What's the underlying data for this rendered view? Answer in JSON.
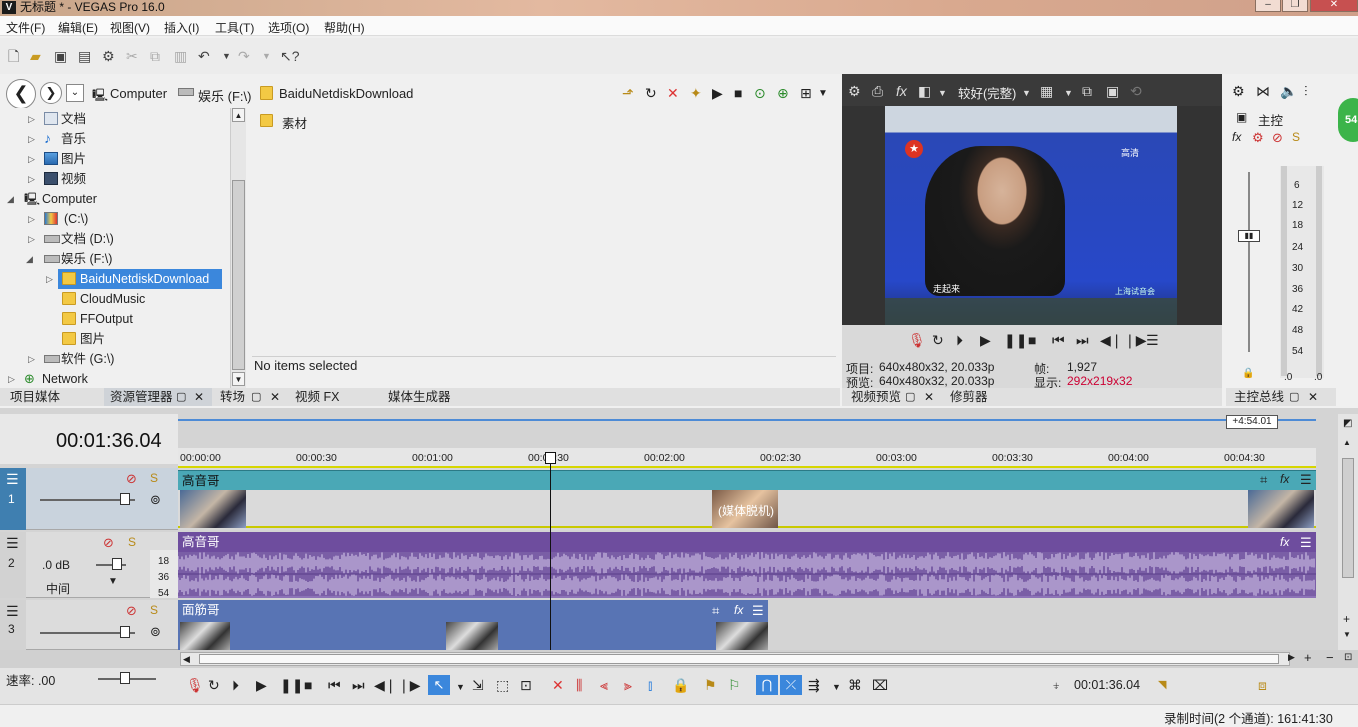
{
  "window": {
    "title": "无标题 * - VEGAS Pro 16.0",
    "logo": "V"
  },
  "menu": [
    "文件(F)",
    "编辑(E)",
    "视图(V)",
    "插入(I)",
    "工具(T)",
    "选项(O)",
    "帮助(H)"
  ],
  "explorer": {
    "path": [
      "Computer",
      "娱乐 (F:\\)",
      "BaiduNetdiskDownload"
    ],
    "tree": [
      {
        "label": "文档",
        "indent": 1,
        "icon": "documents-icon"
      },
      {
        "label": "音乐",
        "indent": 1,
        "icon": "music-icon"
      },
      {
        "label": "图片",
        "indent": 1,
        "icon": "pictures-icon"
      },
      {
        "label": "视频",
        "indent": 1,
        "icon": "videos-icon"
      },
      {
        "label": "Computer",
        "indent": 0,
        "icon": "computer-icon",
        "expanded": true
      },
      {
        "label": "(C:\\)",
        "indent": 1,
        "icon": "drive-icon"
      },
      {
        "label": "文档 (D:\\)",
        "indent": 1,
        "icon": "drive-icon"
      },
      {
        "label": "娱乐 (F:\\)",
        "indent": 1,
        "icon": "drive-icon",
        "expanded": true
      },
      {
        "label": "BaiduNetdiskDownload",
        "indent": 2,
        "icon": "folder-icon",
        "selected": true
      },
      {
        "label": "CloudMusic",
        "indent": 2,
        "icon": "folder-icon"
      },
      {
        "label": "FFOutput",
        "indent": 2,
        "icon": "folder-icon"
      },
      {
        "label": "图片",
        "indent": 2,
        "icon": "folder-icon"
      },
      {
        "label": "软件 (G:\\)",
        "indent": 1,
        "icon": "drive-icon"
      },
      {
        "label": "Network",
        "indent": 0,
        "icon": "network-icon"
      }
    ],
    "folder_items": [
      "素材"
    ],
    "status": "No items selected"
  },
  "left_tabs": [
    "项目媒体",
    "资源管理器",
    "转场",
    "视频 FX",
    "媒体生成器"
  ],
  "preview": {
    "quality": "较好(完整)",
    "project_label": "项目:",
    "project_value": "640x480x32, 20.033p",
    "preview_label": "预览:",
    "preview_value": "640x480x32, 20.033p",
    "frame_label": "帧:",
    "frame_value": "1,927",
    "display_label": "显示:",
    "display_value": "292x219x32",
    "tabs": [
      "视频预览",
      "修剪器"
    ],
    "overlay_caption": "走起来",
    "overlay_hd": "高清",
    "overlay_event": "上海试音会"
  },
  "master": {
    "label": "主控",
    "tab": "主控总线",
    "scale": [
      "6",
      "12",
      "18",
      "24",
      "30",
      "36",
      "42",
      "48",
      "54"
    ],
    "levels": [
      ".0",
      ".0"
    ]
  },
  "timeline": {
    "timecode": "00:01:36.04",
    "end_marker": "+4:54.01",
    "ruler": [
      "00:00:00",
      "00:00:30",
      "00:01:00",
      "00:01:30",
      "00:02:00",
      "00:02:30",
      "00:03:00",
      "00:03:30",
      "00:04:00",
      "00:04:30"
    ],
    "tracks": [
      {
        "num": "1",
        "name": "高音哥",
        "type": "video",
        "clip_label": "(媒体脱机)"
      },
      {
        "num": "2",
        "name": "高音哥",
        "type": "audio",
        "volume": ".0 dB",
        "pan": "中间",
        "meter": [
          "18",
          "36",
          "54"
        ]
      },
      {
        "num": "3",
        "name": "面筋哥",
        "type": "video"
      }
    ],
    "rate_label": "速率: .00",
    "bottom_timecode": "00:01:36.04"
  },
  "status_bar": "录制时间(2 个通道): 161:41:30",
  "badge": "54",
  "colors": {
    "video_track": "#4aa8b6",
    "audio_track": "#6e4d9e",
    "video3_track": "#5874b4",
    "selection": "#3b87dc"
  }
}
